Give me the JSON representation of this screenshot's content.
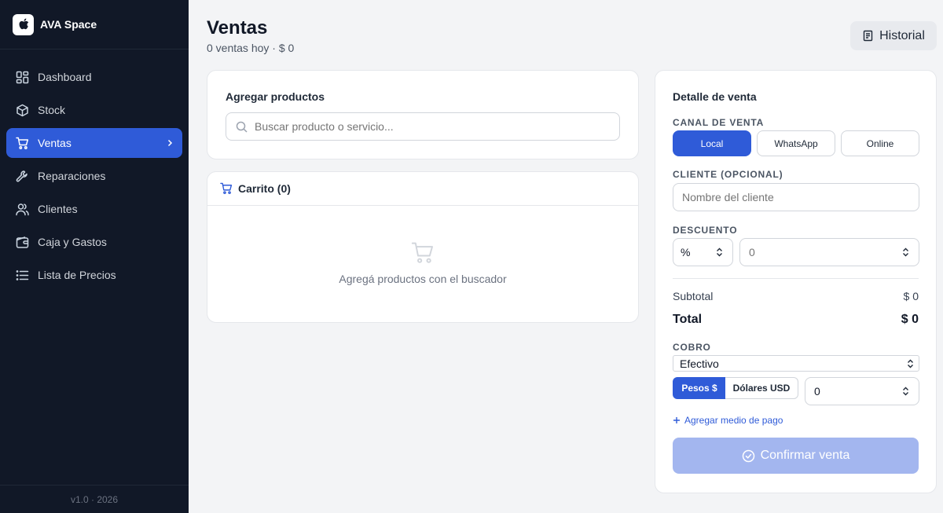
{
  "app": {
    "name": "AVA Space",
    "version": "v1.0 · 2026"
  },
  "sidebar": {
    "items": [
      {
        "label": "Dashboard",
        "icon": "dashboard-icon"
      },
      {
        "label": "Stock",
        "icon": "box-icon"
      },
      {
        "label": "Ventas",
        "icon": "cart-icon",
        "active": true
      },
      {
        "label": "Reparaciones",
        "icon": "wrench-icon"
      },
      {
        "label": "Clientes",
        "icon": "users-icon"
      },
      {
        "label": "Caja y Gastos",
        "icon": "wallet-icon"
      },
      {
        "label": "Lista de Precios",
        "icon": "list-icon"
      }
    ]
  },
  "header": {
    "title": "Ventas",
    "subtitle": "0 ventas hoy · $ 0",
    "history_label": "Historial"
  },
  "products": {
    "title": "Agregar productos",
    "search_placeholder": "Buscar producto o servicio..."
  },
  "cart": {
    "title": "Carrito (0)",
    "empty_text": "Agregá productos con el buscador"
  },
  "detail": {
    "title": "Detalle de venta",
    "channel_label": "CANAL DE VENTA",
    "channels": [
      "Local",
      "WhatsApp",
      "Online"
    ],
    "selected_channel": "Local",
    "client_label": "CLIENTE (OPCIONAL)",
    "client_placeholder": "Nombre del cliente",
    "discount_label": "DESCUENTO",
    "discount_type": "%",
    "discount_placeholder": "0",
    "subtotal_label": "Subtotal",
    "subtotal_value": "$ 0",
    "total_label": "Total",
    "total_value": "$ 0",
    "payment_label": "COBRO",
    "payment_method": "Efectivo",
    "currencies": [
      "Pesos $",
      "Dólares USD"
    ],
    "selected_currency": "Pesos $",
    "amount_value": "0",
    "add_payment_label": "Agregar medio de pago",
    "confirm_label": "Confirmar venta"
  },
  "colors": {
    "sidebar_bg": "#111827",
    "accent": "#2f5bd8",
    "confirm_disabled": "#a3b6ef",
    "page_bg": "#f3f4f6"
  }
}
